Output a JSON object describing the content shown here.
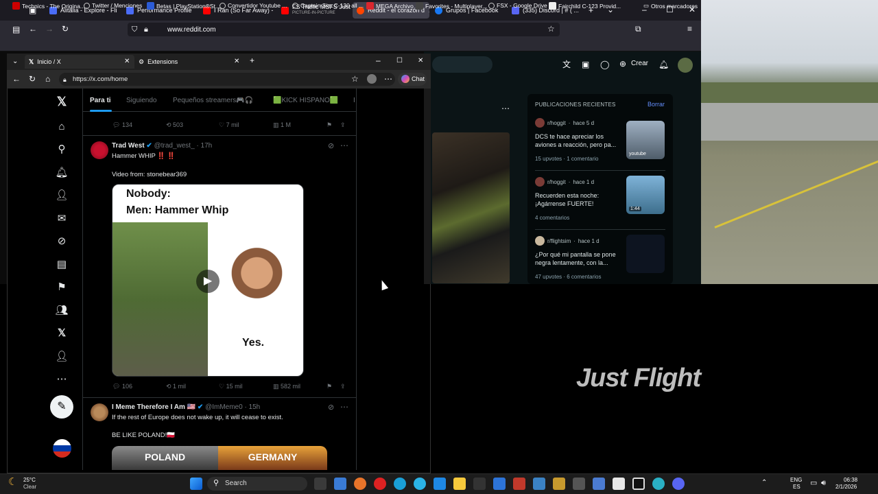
{
  "firefox": {
    "tabs": [
      {
        "label": "Alitalia - Explore - Fli",
        "color": "#4a6cf7"
      },
      {
        "label": "Performance Profile",
        "color": "#4a6cf7"
      },
      {
        "label": "I Ran (So Far Away) -",
        "color": "#ff0000"
      },
      {
        "label": "FS Traffic MSFS Just",
        "sub": "PICTURE-IN-PICTURE",
        "color": "#ff0000"
      },
      {
        "label": "Reddit - el corazón d",
        "color": "#ff4500"
      },
      {
        "label": "Grupos | Facebook",
        "color": "#1877f2"
      },
      {
        "label": "(335) Discord | # ( ...",
        "color": "#5865f2"
      }
    ],
    "url": "www.reddit.com",
    "bookmarks": [
      "Technics - The Origina...",
      "Twitter / Menciones",
      "Betas | PlayStation®St...",
      "Convertidor Youtube ...",
      "Captain Sim C-130 all ...",
      "MEGA Archivo",
      "Favorites - Multiplayer...",
      "FSX - Google Drive",
      "Fairchild C-123 Provid...",
      "Otros marcadores"
    ]
  },
  "reddit": {
    "crear_label": "Crear",
    "recent_title": "PUBLICACIONES RECIENTES",
    "clear_label": "Borrar",
    "posts": [
      {
        "sub": "r/hoggit",
        "time": "hace 5 d",
        "title": "DCS te hace apreciar los aviones a reacción, pero pa...",
        "stats": "15 upvotes · 1 comentario",
        "thumb": "youtube"
      },
      {
        "sub": "r/hoggit",
        "time": "hace 1 d",
        "title": "Recuerden esta noche: ¡Agárrense FUERTE!",
        "stats": "4 comentarios",
        "thumb": "1:44"
      },
      {
        "sub": "r/flightsim",
        "time": "hace 1 d",
        "title": "¿Por qué mi pantalla se pone negra lentamente, con la...",
        "stats": "47 upvotes · 6 comentarios",
        "thumb": ""
      }
    ]
  },
  "edge": {
    "tabs": [
      {
        "label": "Inicio / X"
      },
      {
        "label": "Extensions"
      }
    ],
    "url": "https://x.com/home",
    "chat_label": "Chat"
  },
  "x": {
    "tabs": [
      "Para ti",
      "Siguiendo",
      "Pequeños streamers🎮🎧",
      "🟩KICK HISPANO🟩",
      "I"
    ],
    "top_actions": {
      "replies": "134",
      "reposts": "503",
      "likes": "7 mil",
      "views": "1 M"
    },
    "tweet1": {
      "name": "Trad West",
      "handle": "@trad_west_ · 17h",
      "text1": "Hammer WHIP ‼️ ‼️",
      "text2": "Video from: stonebear369",
      "meme_top1": "Nobody:",
      "meme_top2": "Men:  Hammer Whip",
      "meme_yes": "Yes.",
      "actions": {
        "replies": "106",
        "reposts": "1 mil",
        "likes": "15 mil",
        "views": "582 mil"
      }
    },
    "tweet2": {
      "name": "I Meme Therefore I Am 🇺🇸",
      "handle": "@ImMeme0 · 15h",
      "text1": "If the rest of Europe does not wake up, it will cease to exist.",
      "text2": "BE LIKE POLAND!🇵🇱",
      "img_left": "POLAND",
      "img_right": "GERMANY"
    }
  },
  "justflight": {
    "logo": "Just Flight"
  },
  "taskbar": {
    "weather_temp": "25°C",
    "weather_desc": "Clear",
    "search_placeholder": "Search",
    "lang1": "ENG",
    "lang2": "ES",
    "time": "06:38",
    "date": "2/1/2026"
  }
}
